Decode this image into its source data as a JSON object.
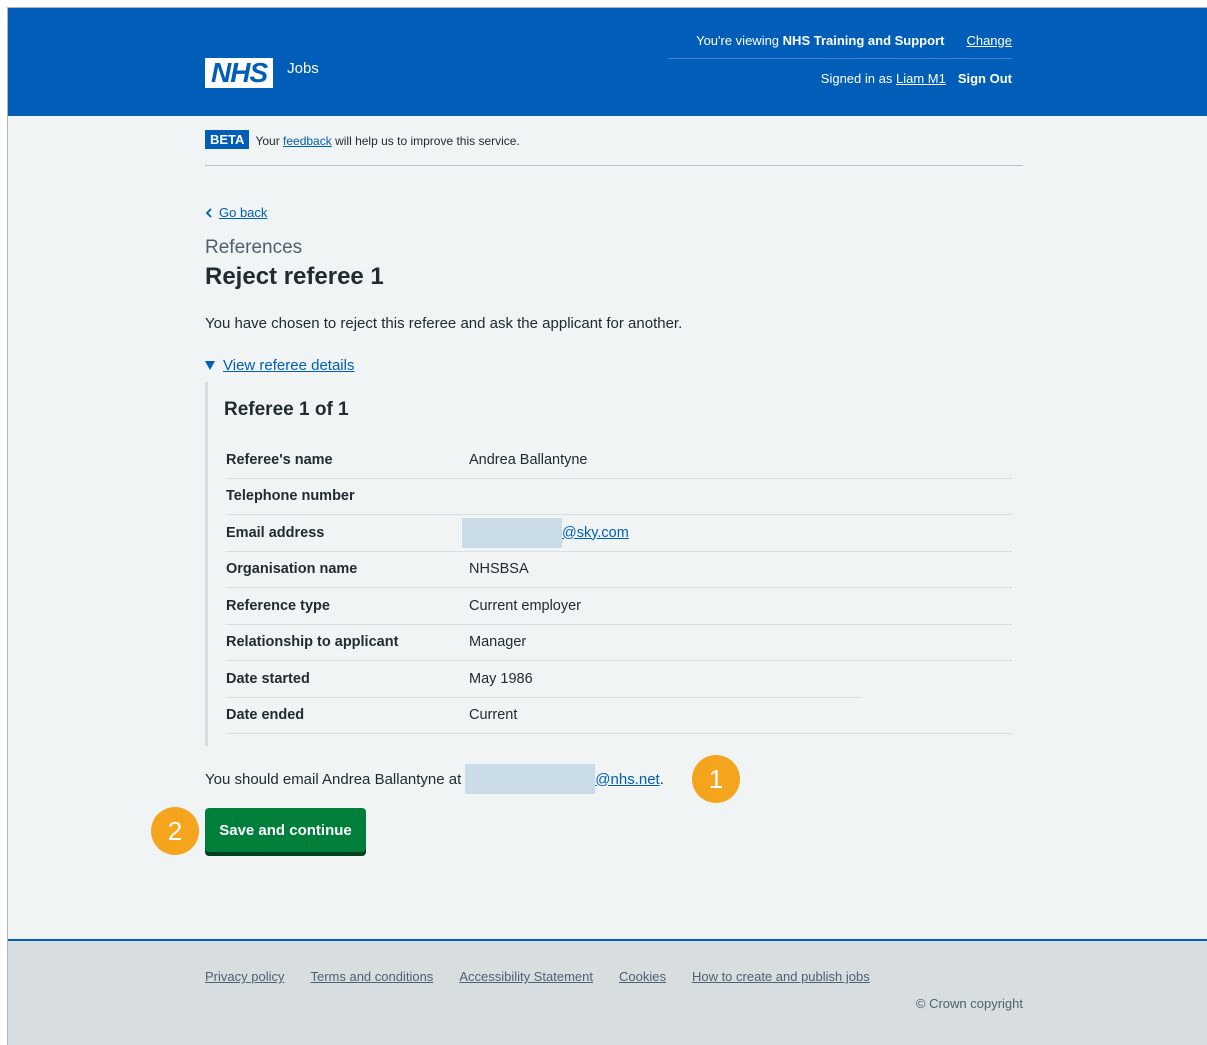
{
  "header": {
    "viewing_prefix": "You're viewing",
    "viewing_org": "NHS Training and Support",
    "change_link": "Change",
    "logo_text": "NHS",
    "logo_sub": "Jobs",
    "signed_in_prefix": "Signed in as",
    "user_name": "Liam M1",
    "sign_out": "Sign Out"
  },
  "beta": {
    "tag": "BETA",
    "prefix": "Your",
    "link": "feedback",
    "suffix": "will help us to improve this service."
  },
  "back_link": "Go back",
  "caption": "References",
  "title": "Reject referee 1",
  "lead": "You have chosen to reject this referee and ask the applicant for another.",
  "details": {
    "summary": "View referee details",
    "heading": "Referee 1 of 1",
    "rows": [
      {
        "key": "Referee's name",
        "value": "Andrea Ballantyne"
      },
      {
        "key": "Telephone number",
        "value": ""
      },
      {
        "key": "Email address",
        "value": "@sky.com"
      },
      {
        "key": "Organisation name",
        "value": "NHSBSA"
      },
      {
        "key": "Reference type",
        "value": "Current employer"
      },
      {
        "key": "Relationship to applicant",
        "value": "Manager"
      },
      {
        "key": "Date started",
        "value": "May 1986"
      },
      {
        "key": "Date ended",
        "value": "Current"
      }
    ]
  },
  "email_instruction": {
    "prefix": "You should email Andrea Ballantyne at",
    "email_suffix": "@nhs.net",
    "end": "."
  },
  "badges": [
    "1",
    "2"
  ],
  "button": "Save and continue",
  "footer": {
    "links": [
      "Privacy policy",
      "Terms and conditions",
      "Accessibility Statement",
      "Cookies",
      "How to create and publish jobs"
    ],
    "copyright": "© Crown copyright"
  },
  "colors": {
    "nhs_blue": "#005eb8",
    "button_green": "#007f3b",
    "badge_orange": "#f5a41d"
  }
}
